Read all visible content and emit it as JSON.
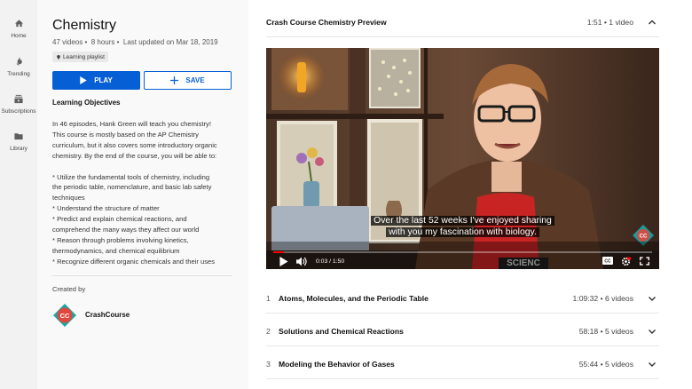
{
  "nav": {
    "items": [
      {
        "label": "Home",
        "icon": "home-icon"
      },
      {
        "label": "Trending",
        "icon": "flame-icon"
      },
      {
        "label": "Subscriptions",
        "icon": "subscriptions-icon"
      },
      {
        "label": "Library",
        "icon": "folder-icon"
      }
    ]
  },
  "playlist": {
    "title": "Chemistry",
    "video_count": "47 videos",
    "duration": "8 hours",
    "updated": "Last updated on Mar 18, 2019",
    "tag": "Learning playlist",
    "play_label": "PLAY",
    "save_label": "SAVE",
    "objectives_heading": "Learning Objectives",
    "description": "In 46 episodes, Hank Green will teach you chemistry!\nThis course is mostly based on the AP Chemistry\ncurriculum, but it also covers some introductory organic\nchemistry. By the end of the course, you will be able to:\n\n* Utilize the fundamental tools of chemistry, including\nthe periodic table, nomenclature, and basic lab safety\ntechniques\n* Understand the structure of matter\n* Predict and explain chemical reactions, and\ncomprehend the many ways they affect our world\n* Reason through problems involving kinetics,\nthermodynamics, and chemical equilibrium\n* Recognize different organic chemicals and their uses",
    "created_by_label": "Created by",
    "creator": "CrashCourse",
    "creator_logo_text": "CC"
  },
  "preview": {
    "title": "Crash Course Chemistry Preview",
    "meta": "1:51 • 1 video"
  },
  "video": {
    "caption_line1": "Over the last 52 weeks I've enjoyed sharing",
    "caption_line2": "with you my fascination with biology.",
    "time": "0:03 / 1:50",
    "progress": 0.027,
    "shirt_text": "SCIENC",
    "watermark_text": "CC"
  },
  "sections": [
    {
      "num": "1",
      "title": "Atoms, Molecules, and the Periodic Table",
      "meta": "1:09:32 • 6 videos"
    },
    {
      "num": "2",
      "title": "Solutions and Chemical Reactions",
      "meta": "58:18 • 5 videos"
    },
    {
      "num": "3",
      "title": "Modeling the Behavior of Gases",
      "meta": "55:44 • 5 videos"
    }
  ],
  "colors": {
    "accent": "#065fd4",
    "progress": "#ff0000",
    "cc_teal": "#1aa6a6",
    "cc_red": "#e0483e"
  }
}
